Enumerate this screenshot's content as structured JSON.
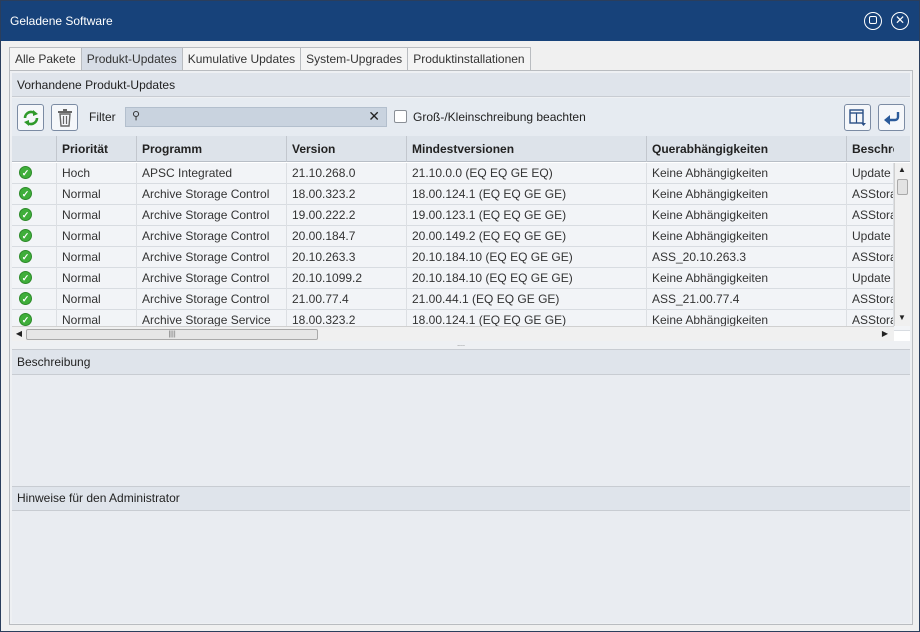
{
  "window": {
    "title": "Geladene Software"
  },
  "tabs": [
    {
      "label": "Alle Pakete",
      "active": false
    },
    {
      "label": "Produkt-Updates",
      "active": true
    },
    {
      "label": "Kumulative Updates",
      "active": false
    },
    {
      "label": "System-Upgrades",
      "active": false
    },
    {
      "label": "Produktinstallationen",
      "active": false
    }
  ],
  "updates_section": {
    "title": "Vorhandene Produkt-Updates"
  },
  "toolbar": {
    "refresh_icon": "refresh-icon",
    "delete_icon": "trash-icon",
    "filter_label": "Filter",
    "filter_value": "",
    "case_label": "Groß-/Kleinschreibung beachten",
    "case_checked": false,
    "columns_icon": "columns-icon",
    "back_icon": "back-arrow-icon"
  },
  "table": {
    "columns": [
      "",
      "Priorität",
      "Programm",
      "Version",
      "Mindestversionen",
      "Querabhängigkeiten",
      "Beschreib"
    ],
    "rows": [
      {
        "status": "ok",
        "priority": "Hoch",
        "program": "APSC Integrated",
        "version": "21.10.268.0",
        "min": "21.10.0.0 (EQ EQ GE EQ)",
        "deps": "Keine Abhängigkeiten",
        "desc": "Update"
      },
      {
        "status": "ok",
        "priority": "Normal",
        "program": "Archive Storage Control",
        "version": "18.00.323.2",
        "min": "18.00.124.1 (EQ EQ GE GE)",
        "deps": "Keine Abhängigkeiten",
        "desc": "ASStora"
      },
      {
        "status": "ok",
        "priority": "Normal",
        "program": "Archive Storage Control",
        "version": "19.00.222.2",
        "min": "19.00.123.1 (EQ EQ GE GE)",
        "deps": "Keine Abhängigkeiten",
        "desc": "ASStora"
      },
      {
        "status": "ok",
        "priority": "Normal",
        "program": "Archive Storage Control",
        "version": "20.00.184.7",
        "min": "20.00.149.2 (EQ EQ GE GE)",
        "deps": "Keine Abhängigkeiten",
        "desc": "Update"
      },
      {
        "status": "ok",
        "priority": "Normal",
        "program": "Archive Storage Control",
        "version": "20.10.263.3",
        "min": "20.10.184.10 (EQ EQ GE GE)",
        "deps": "ASS_20.10.263.3",
        "desc": "ASStora"
      },
      {
        "status": "ok",
        "priority": "Normal",
        "program": "Archive Storage Control",
        "version": "20.10.1099.2",
        "min": "20.10.184.10 (EQ EQ GE GE)",
        "deps": "Keine Abhängigkeiten",
        "desc": "Update"
      },
      {
        "status": "ok",
        "priority": "Normal",
        "program": "Archive Storage Control",
        "version": "21.00.77.4",
        "min": "21.00.44.1 (EQ EQ GE GE)",
        "deps": "ASS_21.00.77.4",
        "desc": "ASStora"
      },
      {
        "status": "ok",
        "priority": "Normal",
        "program": "Archive Storage Service",
        "version": "18.00.323.2",
        "min": "18.00.124.1 (EQ EQ GE GE)",
        "deps": "Keine Abhängigkeiten",
        "desc": "ASStora"
      }
    ]
  },
  "description_section": {
    "title": "Beschreibung"
  },
  "admin_section": {
    "title": "Hinweise für den Administrator"
  },
  "colors": {
    "titlebar": "#17427a",
    "status_ok": "#3fae3a",
    "header_bg": "#dde3ea"
  }
}
